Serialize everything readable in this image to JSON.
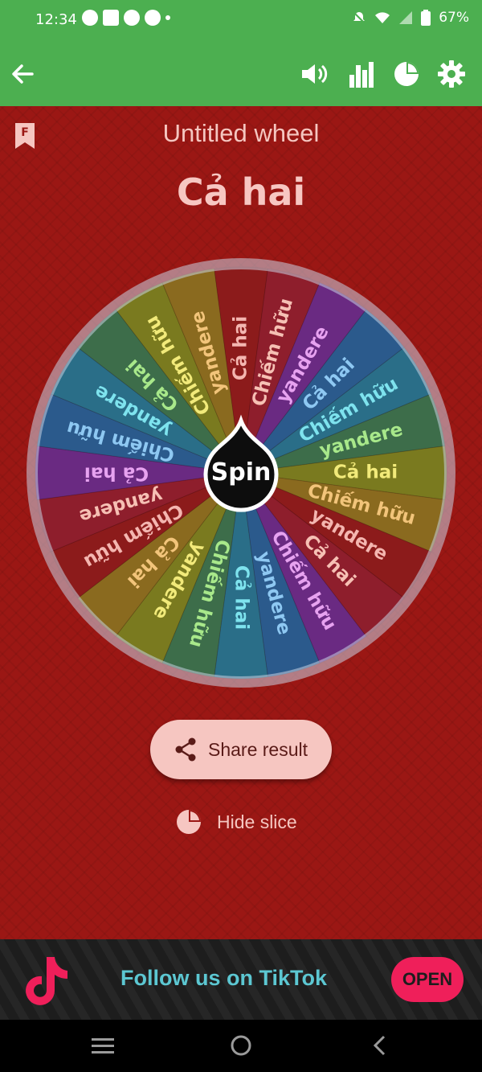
{
  "status": {
    "time": "12:34",
    "battery": "67%"
  },
  "toolbar": {
    "icons": [
      "back-arrow-icon",
      "volume-icon",
      "bar-chart-icon",
      "pie-chart-icon",
      "gear-icon"
    ]
  },
  "wheel": {
    "title": "Untitled wheel",
    "result": "Cả hai",
    "spin_label": "Spin",
    "slices": [
      "Cả hai",
      "Chiếm hữu",
      "yandere",
      "Cả hai",
      "Chiếm hữu",
      "yandere",
      "Cả hai",
      "Chiếm hữu",
      "yandere",
      "Cả hai",
      "Chiếm hữu",
      "yandere",
      "Cả hai",
      "Chiếm hữu",
      "yandere",
      "Cả hai",
      "Chiếm hữu",
      "yandere",
      "Cả hai",
      "Chiếm hữu",
      "yandere",
      "Cả hai",
      "Chiếm hữu",
      "yandere"
    ],
    "slice_colors": [
      "#8c1b1b",
      "#8e1e2c",
      "#6a2a82",
      "#2b5a8c",
      "#2a6e88",
      "#3d6d4a",
      "#7a7a1f",
      "#8a6a1f",
      "#8c1b1b",
      "#8e1e2c",
      "#6a2a82",
      "#2b5a8c",
      "#2a6e88",
      "#3d6d4a",
      "#7a7a1f",
      "#8a6a1f",
      "#8c1b1b",
      "#8e1e2c",
      "#6a2a82",
      "#2b5a8c",
      "#2a6e88",
      "#3d6d4a",
      "#7a7a1f",
      "#8a6a1f"
    ],
    "text_colors": [
      "#f4b6b0",
      "#f6c0b4",
      "#e7a2f0",
      "#8ec8f2",
      "#7ee3ee",
      "#a8e88a",
      "#f2ea7a",
      "#f2c47a",
      "#f4b6b0",
      "#f6c0b4",
      "#e7a2f0",
      "#8ec8f2",
      "#7ee3ee",
      "#a8e88a",
      "#f2ea7a",
      "#f2c47a",
      "#f4b6b0",
      "#f6c0b4",
      "#e7a2f0",
      "#8ec8f2",
      "#7ee3ee",
      "#a8e88a",
      "#f2ea7a",
      "#f2c47a"
    ]
  },
  "actions": {
    "share_label": "Share result",
    "hide_label": "Hide slice"
  },
  "ad": {
    "text": "Follow us on TikTok",
    "button": "OPEN"
  }
}
